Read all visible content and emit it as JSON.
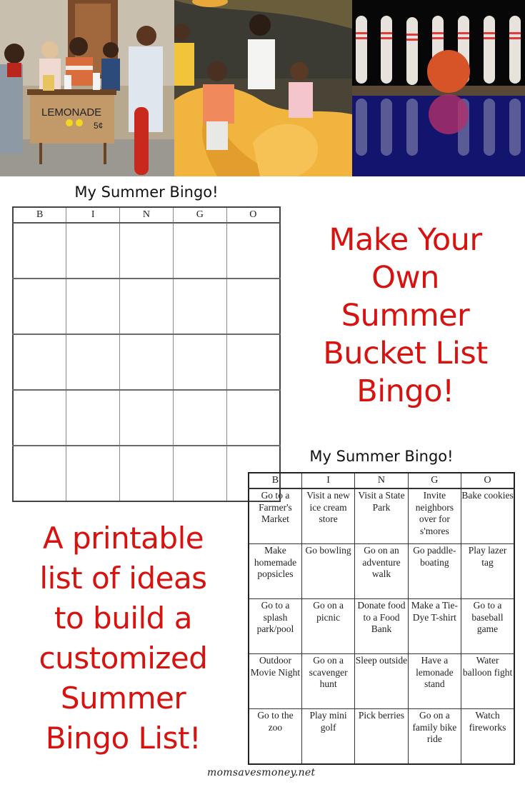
{
  "photos": [
    {
      "subject": "Kids running a lemonade stand",
      "sign_text": "LEMONADE",
      "sign_price": "5¢"
    },
    {
      "subject": "Family riding a yellow paddle boat in life vests"
    },
    {
      "subject": "Bowling pins with orange bowling ball"
    }
  ],
  "blank_card": {
    "title": "My Summer Bingo!",
    "headers": [
      "B",
      "I",
      "N",
      "G",
      "O"
    ],
    "rows": 5
  },
  "headline_top": {
    "lines": [
      "Make Your",
      "Own",
      "Summer",
      "Bucket List",
      "Bingo!"
    ]
  },
  "filled_card": {
    "title": "My Summer Bingo!",
    "headers": [
      "B",
      "I",
      "N",
      "G",
      "O"
    ],
    "rows": [
      [
        "Go to a Farmer's Market",
        "Visit a new ice cream store",
        "Visit a State Park",
        "Invite neighbors over for s'mores",
        "Bake cookies"
      ],
      [
        "Make homemade popsicles",
        "Go bowling",
        "Go on an adventure walk",
        "Go paddle-boating",
        "Play lazer tag"
      ],
      [
        "Go to a splash park/pool",
        "Go on a picnic",
        "Donate food to a Food Bank",
        "Make a Tie-Dye T-shirt",
        "Go to a baseball game"
      ],
      [
        "Outdoor Movie Night",
        "Go on a scavenger hunt",
        "Sleep outside",
        "Have a lemonade stand",
        "Water balloon fight"
      ],
      [
        "Go to the zoo",
        "Play mini golf",
        "Pick berries",
        "Go on a family bike ride",
        "Watch fireworks"
      ]
    ]
  },
  "headline_bottom": {
    "lines": [
      "A printable",
      "list of ideas",
      "to build a",
      "customized",
      "Summer",
      "Bingo List!"
    ]
  },
  "credit": "momsavesmoney.net",
  "colors": {
    "headline": "#d7120f"
  }
}
